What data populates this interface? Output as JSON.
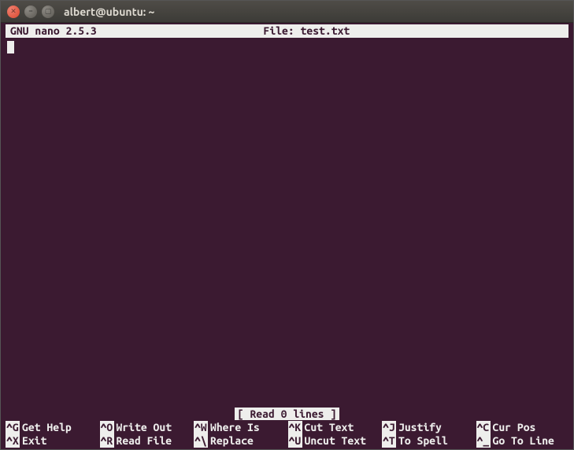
{
  "window": {
    "title": "albert@ubuntu: ~"
  },
  "header": {
    "app_version": "GNU nano 2.5.3",
    "file_label": "File: test.txt"
  },
  "status": {
    "message": "[ Read 0 lines ]"
  },
  "shortcuts": {
    "row1": [
      {
        "key": "^G",
        "label": "Get Help"
      },
      {
        "key": "^O",
        "label": "Write Out"
      },
      {
        "key": "^W",
        "label": "Where Is"
      },
      {
        "key": "^K",
        "label": "Cut Text"
      },
      {
        "key": "^J",
        "label": "Justify"
      },
      {
        "key": "^C",
        "label": "Cur Pos"
      }
    ],
    "row2": [
      {
        "key": "^X",
        "label": "Exit"
      },
      {
        "key": "^R",
        "label": "Read File"
      },
      {
        "key": "^\\",
        "label": "Replace"
      },
      {
        "key": "^U",
        "label": "Uncut Text"
      },
      {
        "key": "^T",
        "label": "To Spell"
      },
      {
        "key": "^_",
        "label": "Go To Line"
      }
    ]
  }
}
